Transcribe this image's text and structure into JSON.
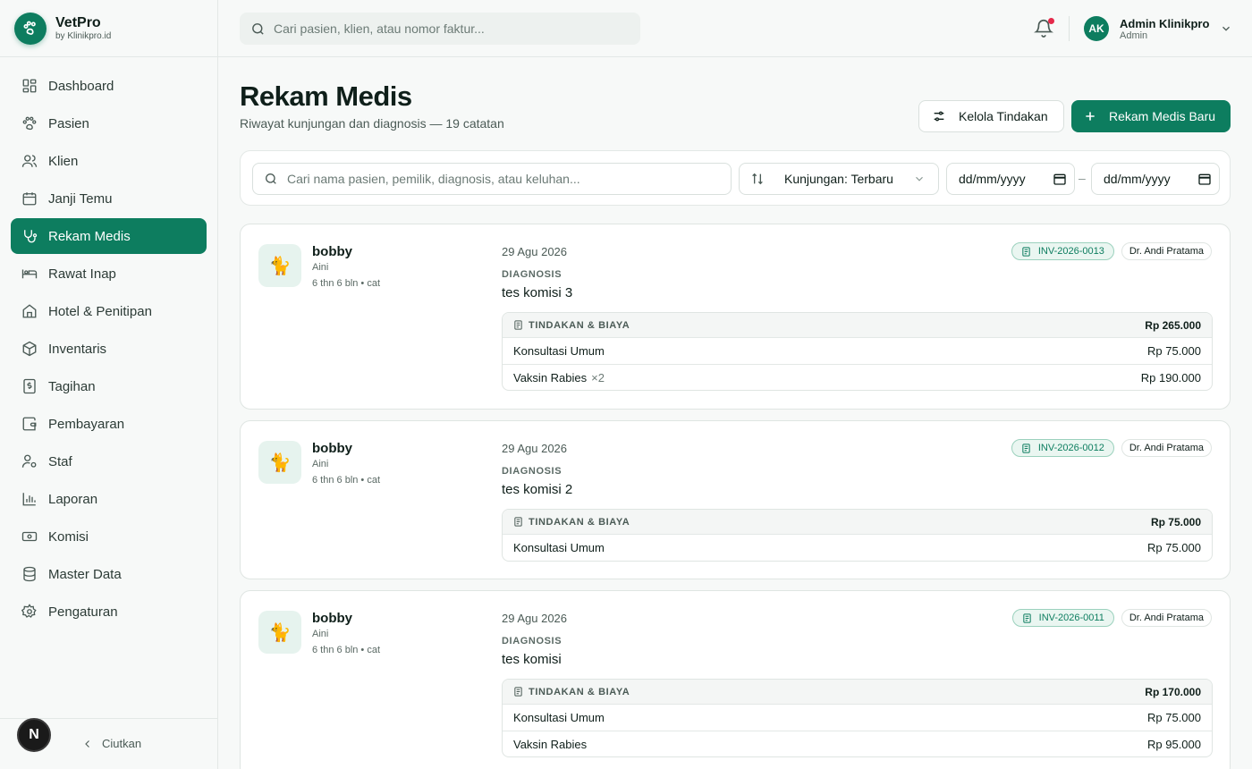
{
  "brand": {
    "name": "VetPro",
    "sub": "by Klinikpro.id"
  },
  "nav": [
    {
      "label": "Dashboard",
      "icon": "dashboard-icon"
    },
    {
      "label": "Pasien",
      "icon": "paw-icon"
    },
    {
      "label": "Klien",
      "icon": "users-icon"
    },
    {
      "label": "Janji Temu",
      "icon": "calendar-icon"
    },
    {
      "label": "Rekam Medis",
      "icon": "stethoscope-icon",
      "active": true
    },
    {
      "label": "Rawat Inap",
      "icon": "bed-icon"
    },
    {
      "label": "Hotel & Penitipan",
      "icon": "home-icon"
    },
    {
      "label": "Inventaris",
      "icon": "box-icon"
    },
    {
      "label": "Tagihan",
      "icon": "bill-icon"
    },
    {
      "label": "Pembayaran",
      "icon": "wallet-icon"
    },
    {
      "label": "Staf",
      "icon": "user-gear-icon"
    },
    {
      "label": "Laporan",
      "icon": "chart-icon"
    },
    {
      "label": "Komisi",
      "icon": "money-icon"
    },
    {
      "label": "Master Data",
      "icon": "database-icon"
    },
    {
      "label": "Pengaturan",
      "icon": "gear-icon"
    }
  ],
  "footer": {
    "badge": "N",
    "collapse_label": "Ciutkan"
  },
  "topbar": {
    "search_placeholder": "Cari pasien, klien, atau nomor faktur...",
    "user": {
      "initials": "AK",
      "name": "Admin Klinikpro",
      "role": "Admin"
    }
  },
  "page": {
    "title": "Rekam Medis",
    "subtitle": "Riwayat kunjungan dan diagnosis — 19 catatan",
    "manage_button": "Kelola Tindakan",
    "new_button": "Rekam Medis Baru"
  },
  "filters": {
    "search_placeholder": "Cari nama pasien, pemilik, diagnosis, atau keluhan...",
    "sort_label": "Kunjungan: Terbaru",
    "date_from": "dd/mm/yyyy",
    "date_to": "dd/mm/yyyy",
    "separator": "–"
  },
  "labels": {
    "diagnosis": "DIAGNOSIS",
    "treatments": "TINDAKAN & BIAYA"
  },
  "records": [
    {
      "pet_emoji": "🐈",
      "pet_name": "bobby",
      "owner": "Aini",
      "meta": "6 thn 6 bln • cat",
      "date": "29 Agu 2026",
      "invoice": "INV-2026-0013",
      "doctor": "Dr. Andi Pratama",
      "diagnosis": "tes komisi 3",
      "total": "Rp 265.000",
      "items": [
        {
          "name": "Konsultasi Umum",
          "qty": "",
          "price": "Rp 75.000"
        },
        {
          "name": "Vaksin Rabies",
          "qty": "×2",
          "price": "Rp 190.000"
        }
      ]
    },
    {
      "pet_emoji": "🐈",
      "pet_name": "bobby",
      "owner": "Aini",
      "meta": "6 thn 6 bln • cat",
      "date": "29 Agu 2026",
      "invoice": "INV-2026-0012",
      "doctor": "Dr. Andi Pratama",
      "diagnosis": "tes komisi 2",
      "total": "Rp 75.000",
      "items": [
        {
          "name": "Konsultasi Umum",
          "qty": "",
          "price": "Rp 75.000"
        }
      ]
    },
    {
      "pet_emoji": "🐈",
      "pet_name": "bobby",
      "owner": "Aini",
      "meta": "6 thn 6 bln • cat",
      "date": "29 Agu 2026",
      "invoice": "INV-2026-0011",
      "doctor": "Dr. Andi Pratama",
      "diagnosis": "tes komisi",
      "total": "Rp 170.000",
      "items": [
        {
          "name": "Konsultasi Umum",
          "qty": "",
          "price": "Rp 75.000"
        },
        {
          "name": "Vaksin Rabies",
          "qty": "",
          "price": "Rp 95.000"
        }
      ]
    }
  ],
  "colors": {
    "accent": "#0d7d5f",
    "notification": "#e5294a"
  }
}
